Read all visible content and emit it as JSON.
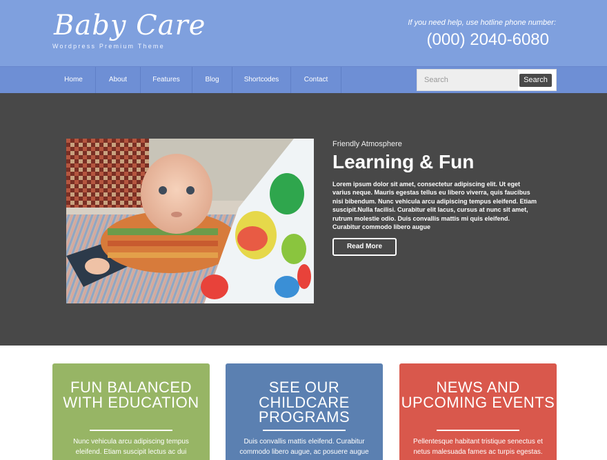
{
  "header": {
    "logo_title": "Baby Care",
    "logo_subtitle": "Wordpress Premium Theme",
    "help_text": "If you need help, use hotline phone number:",
    "phone": "(000) 2040-6080"
  },
  "nav": {
    "items": [
      {
        "label": "Home"
      },
      {
        "label": "About"
      },
      {
        "label": "Features"
      },
      {
        "label": "Blog"
      },
      {
        "label": "Shortcodes"
      },
      {
        "label": "Contact"
      }
    ]
  },
  "search": {
    "placeholder": "Search",
    "button_label": "Search"
  },
  "hero": {
    "kicker": "Friendly Atmosphere",
    "title": "Learning & Fun",
    "text": "Lorem ipsum dolor sit amet, consectetur adipiscing elit. Ut eget varius neque. Mauris egestas tellus eu libero viverra, quis faucibus nisi bibendum. Nunc vehicula arcu adipiscing tempus eleifend. Etiam suscipit.Nulla facilisi. Curabitur elit lacus, cursus at nunc sit amet, rutrum molestie odio. Duis convallis mattis mi quis eleifend. Curabitur commodo libero augue",
    "button_label": "Read More"
  },
  "boxes": [
    {
      "title": "FUN BALANCED WITH EDUCATION",
      "text": "Nunc vehicula arcu adipiscing tempus eleifend. Etiam suscipit lectus ac dui",
      "color": "#97b565"
    },
    {
      "title": "SEE OUR CHILDCARE PROGRAMS",
      "text": "Duis convallis mattis eleifend. Curabitur commodo libero augue, ac posuere augue",
      "color": "#5b80b1"
    },
    {
      "title": "NEWS AND UPCOMING EVENTS",
      "text": "Pellentesque habitant tristique senectus et netus malesuada fames ac turpis egestas.",
      "color": "#d9584c"
    }
  ],
  "colors": {
    "header_bg": "#7fa0de",
    "nav_bg": "#6e8fd5",
    "hero_bg": "#484848"
  }
}
